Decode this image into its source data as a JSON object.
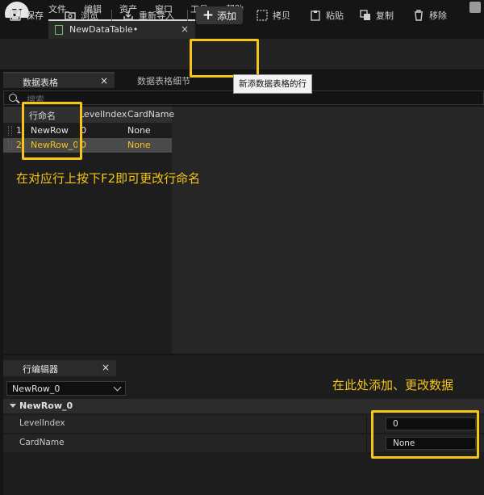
{
  "menu": {
    "items": [
      "文件",
      "编辑",
      "资产",
      "窗口",
      "工具",
      "帮助"
    ]
  },
  "logo": {
    "glyph": "U"
  },
  "document_tab": {
    "label": "NewDataTable•",
    "close": "×"
  },
  "toolbar": {
    "save": "保存",
    "browse": "浏览",
    "reimport": "重新导入",
    "add": "添加",
    "copy": "拷贝",
    "paste": "粘贴",
    "duplicate": "复制",
    "remove": "移除"
  },
  "tooltip": {
    "text": "新添数据表格的行"
  },
  "table_panel": {
    "tab_label": "数据表格",
    "tab_close": "×",
    "details_tab_label": "数据表格细节",
    "search_placeholder": "搜索",
    "columns": [
      "行命名",
      "LevelIndex",
      "CardName"
    ],
    "rows": [
      {
        "index": "1",
        "name": "NewRow",
        "level_index": "0",
        "card_name": "None",
        "selected": false
      },
      {
        "index": "2",
        "name": "NewRow_0",
        "level_index": "0",
        "card_name": "None",
        "selected": true
      }
    ]
  },
  "annotations": {
    "rename_hint": "在对应行上按下F2即可更改行命名",
    "edit_hint": "在此处添加、更改数据"
  },
  "row_editor": {
    "tab_label": "行编辑器",
    "tab_close": "×",
    "selected_row": "NewRow_0",
    "category": "NewRow_0",
    "properties": [
      {
        "label": "LevelIndex",
        "value": "0"
      },
      {
        "label": "CardName",
        "value": "None"
      }
    ]
  },
  "colors": {
    "accent": "#f5c518",
    "selected_row_bg": "#4a4a4a",
    "selected_text": "#f5c518"
  }
}
